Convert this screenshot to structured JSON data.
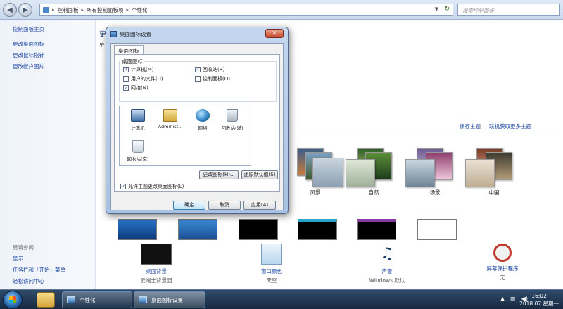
{
  "address": {
    "crumbs": [
      "控制面板",
      "所有控制面板项",
      "个性化"
    ],
    "search_placeholder": "搜索控制面板"
  },
  "left_pane": {
    "links": [
      "控制面板主页",
      "更改桌面图标",
      "更改鼠标指针",
      "更改帐户图片"
    ],
    "see_also_title": "另请参阅",
    "see_also": [
      "显示",
      "任务栏和「开始」菜单",
      "轻松访问中心"
    ]
  },
  "main": {
    "title": "更",
    "subtitle": "单",
    "save_theme": "保存主题",
    "get_more_themes": "联机获取更多主题",
    "themes": [
      {
        "name": "风景"
      },
      {
        "name": "自然"
      },
      {
        "name": "场景"
      },
      {
        "name": "中国"
      }
    ]
  },
  "bottom": [
    {
      "label": "桌面背景",
      "value": "云端士背景园"
    },
    {
      "label": "窗口颜色",
      "value": "天空"
    },
    {
      "label": "声音",
      "value": "Windows 默认"
    },
    {
      "label": "屏幕保护程序",
      "value": "无"
    }
  ],
  "dialog": {
    "title": "桌面图标设置",
    "tab": "桌面图标",
    "group_title": "桌面图标",
    "checkboxes": [
      {
        "label": "计算机(M)",
        "checked": true
      },
      {
        "label": "回收站(R)",
        "checked": true
      },
      {
        "label": "用户的文件(U)",
        "checked": false
      },
      {
        "label": "控制面板(O)",
        "checked": false
      },
      {
        "label": "网络(N)",
        "checked": true
      }
    ],
    "icons": [
      "计算机",
      "Administ...",
      "网络",
      "回收站(满)",
      "回收站(空)"
    ],
    "change_icon": "更改图标(H)...",
    "restore_default": "还原默认值(S)",
    "allow_themes": "允许主题更改桌面图标(L)",
    "allow_themes_checked": true,
    "ok": "确定",
    "cancel": "取消",
    "apply": "应用(A)"
  },
  "taskbar": {
    "tasks": [
      "个性化",
      "桌面图标设置"
    ],
    "time": "16:02",
    "date": "2018.07.星期一"
  }
}
